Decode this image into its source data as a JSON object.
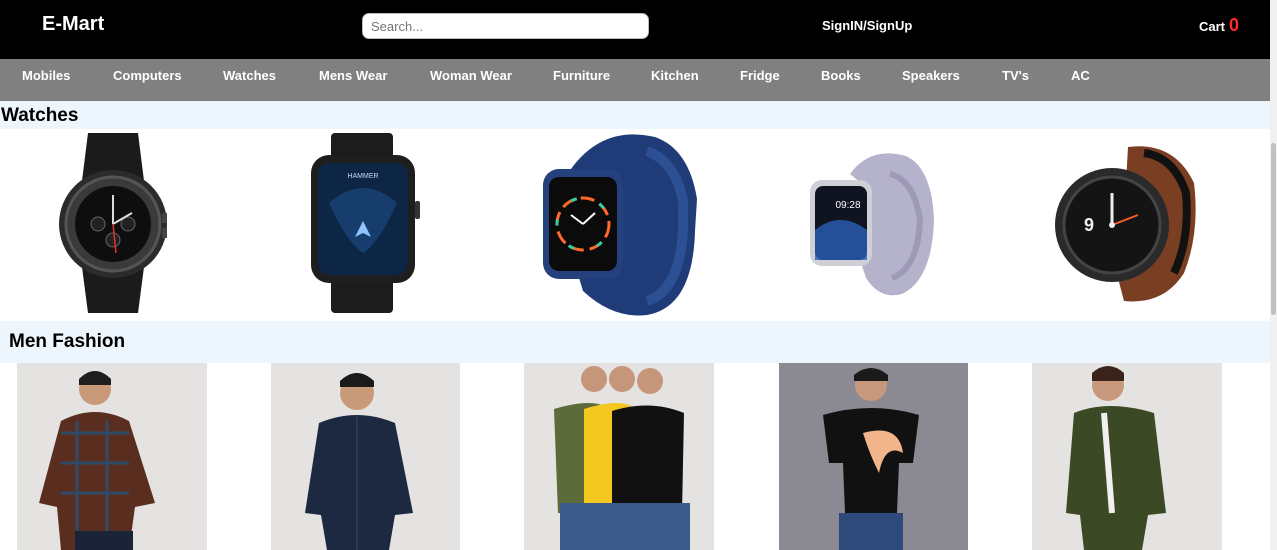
{
  "header": {
    "brand": "E-Mart",
    "search_placeholder": "Search...",
    "signin_label": "SignIN/SignUp",
    "cart_label": "Cart",
    "cart_count": "0"
  },
  "nav": {
    "items": [
      "Mobiles",
      "Computers",
      "Watches",
      "Mens Wear",
      "Woman Wear",
      "Furniture",
      "Kitchen",
      "Fridge",
      "Books",
      "Speakers",
      "TV's",
      "AC"
    ]
  },
  "sections": {
    "watches_title": "Watches",
    "men_fashion_title": "Men Fashion"
  },
  "watch_products": [
    {
      "icon": "round-black-smartwatch-icon",
      "brand": ""
    },
    {
      "icon": "hammer-square-smartwatch-icon",
      "brand": "HAMMER"
    },
    {
      "icon": "blue-square-smartwatch-icon",
      "brand": ""
    },
    {
      "icon": "lavender-smartwatch-icon",
      "brand": "",
      "time": "09:28"
    },
    {
      "icon": "round-brown-leather-smartwatch-icon",
      "brand": ""
    }
  ],
  "men_products": [
    {
      "icon": "checked-shirt-model-image",
      "color": "#5a2e1f"
    },
    {
      "icon": "navy-shirt-model-image",
      "color": "#1c2940"
    },
    {
      "icon": "three-tshirt-models-image",
      "color": "#111111"
    },
    {
      "icon": "printed-tshirt-model-image",
      "color": "#111111"
    },
    {
      "icon": "green-jacket-model-image",
      "color": "#3b4a24"
    }
  ],
  "colors": {
    "topbar": "#000000",
    "nav": "#808080",
    "section_bg": "#eef6fd",
    "cart_count": "#ff2a2a"
  }
}
